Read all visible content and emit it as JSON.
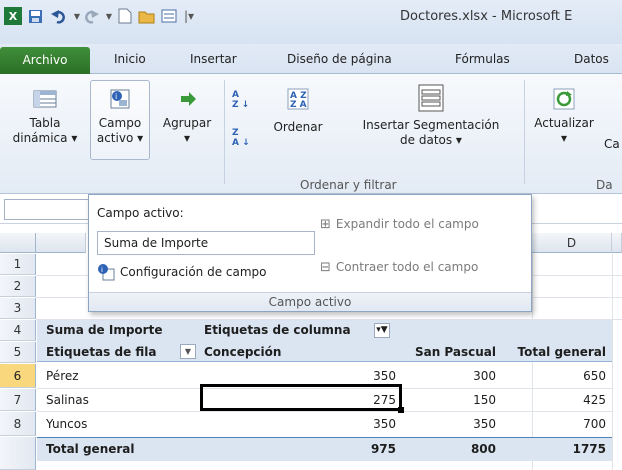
{
  "window": {
    "title": "Doctores.xlsx - Microsoft E"
  },
  "quick_access": {
    "excel_icon": "excel-icon",
    "save_icon": "save-icon",
    "undo_icon": "undo-icon",
    "redo_icon": "redo-icon",
    "new_icon": "new-icon",
    "open_icon": "open-folder-icon",
    "form_icon": "form-icon",
    "customize_icon": "customize-icon"
  },
  "tabs": [
    "Archivo",
    "Inicio",
    "Insertar",
    "Diseño de página",
    "Fórmulas",
    "Datos"
  ],
  "ribbon": {
    "pivot_table": {
      "line1": "Tabla",
      "line2": "dinámica ▾"
    },
    "active_field": {
      "line1": "Campo",
      "line2": "activo ▾"
    },
    "group": {
      "line1": "Agrupar",
      "line2": "▾"
    },
    "sort": {
      "label": "Ordenar"
    },
    "slicer": {
      "line1": "Insertar Segmentación",
      "line2": "de datos ▾"
    },
    "refresh": {
      "line1": "Actualizar",
      "line2": "▾",
      "cut": "Ca"
    },
    "group_label_sort": "Ordenar y filtrar",
    "group_label_data": "Da"
  },
  "popup": {
    "heading": "Campo activo:",
    "field_value": "Suma de Importe",
    "settings_label": "Configuración de campo",
    "expand_label": "Expandir todo el campo",
    "collapse_label": "Contraer todo el campo",
    "footer": "Campo activo"
  },
  "grid": {
    "col_d": "D",
    "rows": [
      "1",
      "2",
      "3",
      "4",
      "5",
      "6",
      "7",
      "8"
    ],
    "r3": {
      "a": "Suma de Importe",
      "b": "Etiquetas de columna"
    },
    "r4": {
      "a": "Etiquetas de fila",
      "b": "Concepción",
      "c": "San Pascual",
      "d": "Total general"
    },
    "r5": {
      "a": "Pérez",
      "b": "350",
      "c": "300",
      "d": "650"
    },
    "r6": {
      "a": "Salinas",
      "b": "275",
      "c": "150",
      "d": "425"
    },
    "r7": {
      "a": "Yuncos",
      "b": "350",
      "c": "350",
      "d": "700"
    },
    "r8": {
      "a": "Total general",
      "b": "975",
      "c": "800",
      "d": "1775"
    }
  },
  "colors": {
    "file_tab": "#2c6e26",
    "header_band": "#dbe5f1",
    "selected_row": "#f8d77d"
  }
}
